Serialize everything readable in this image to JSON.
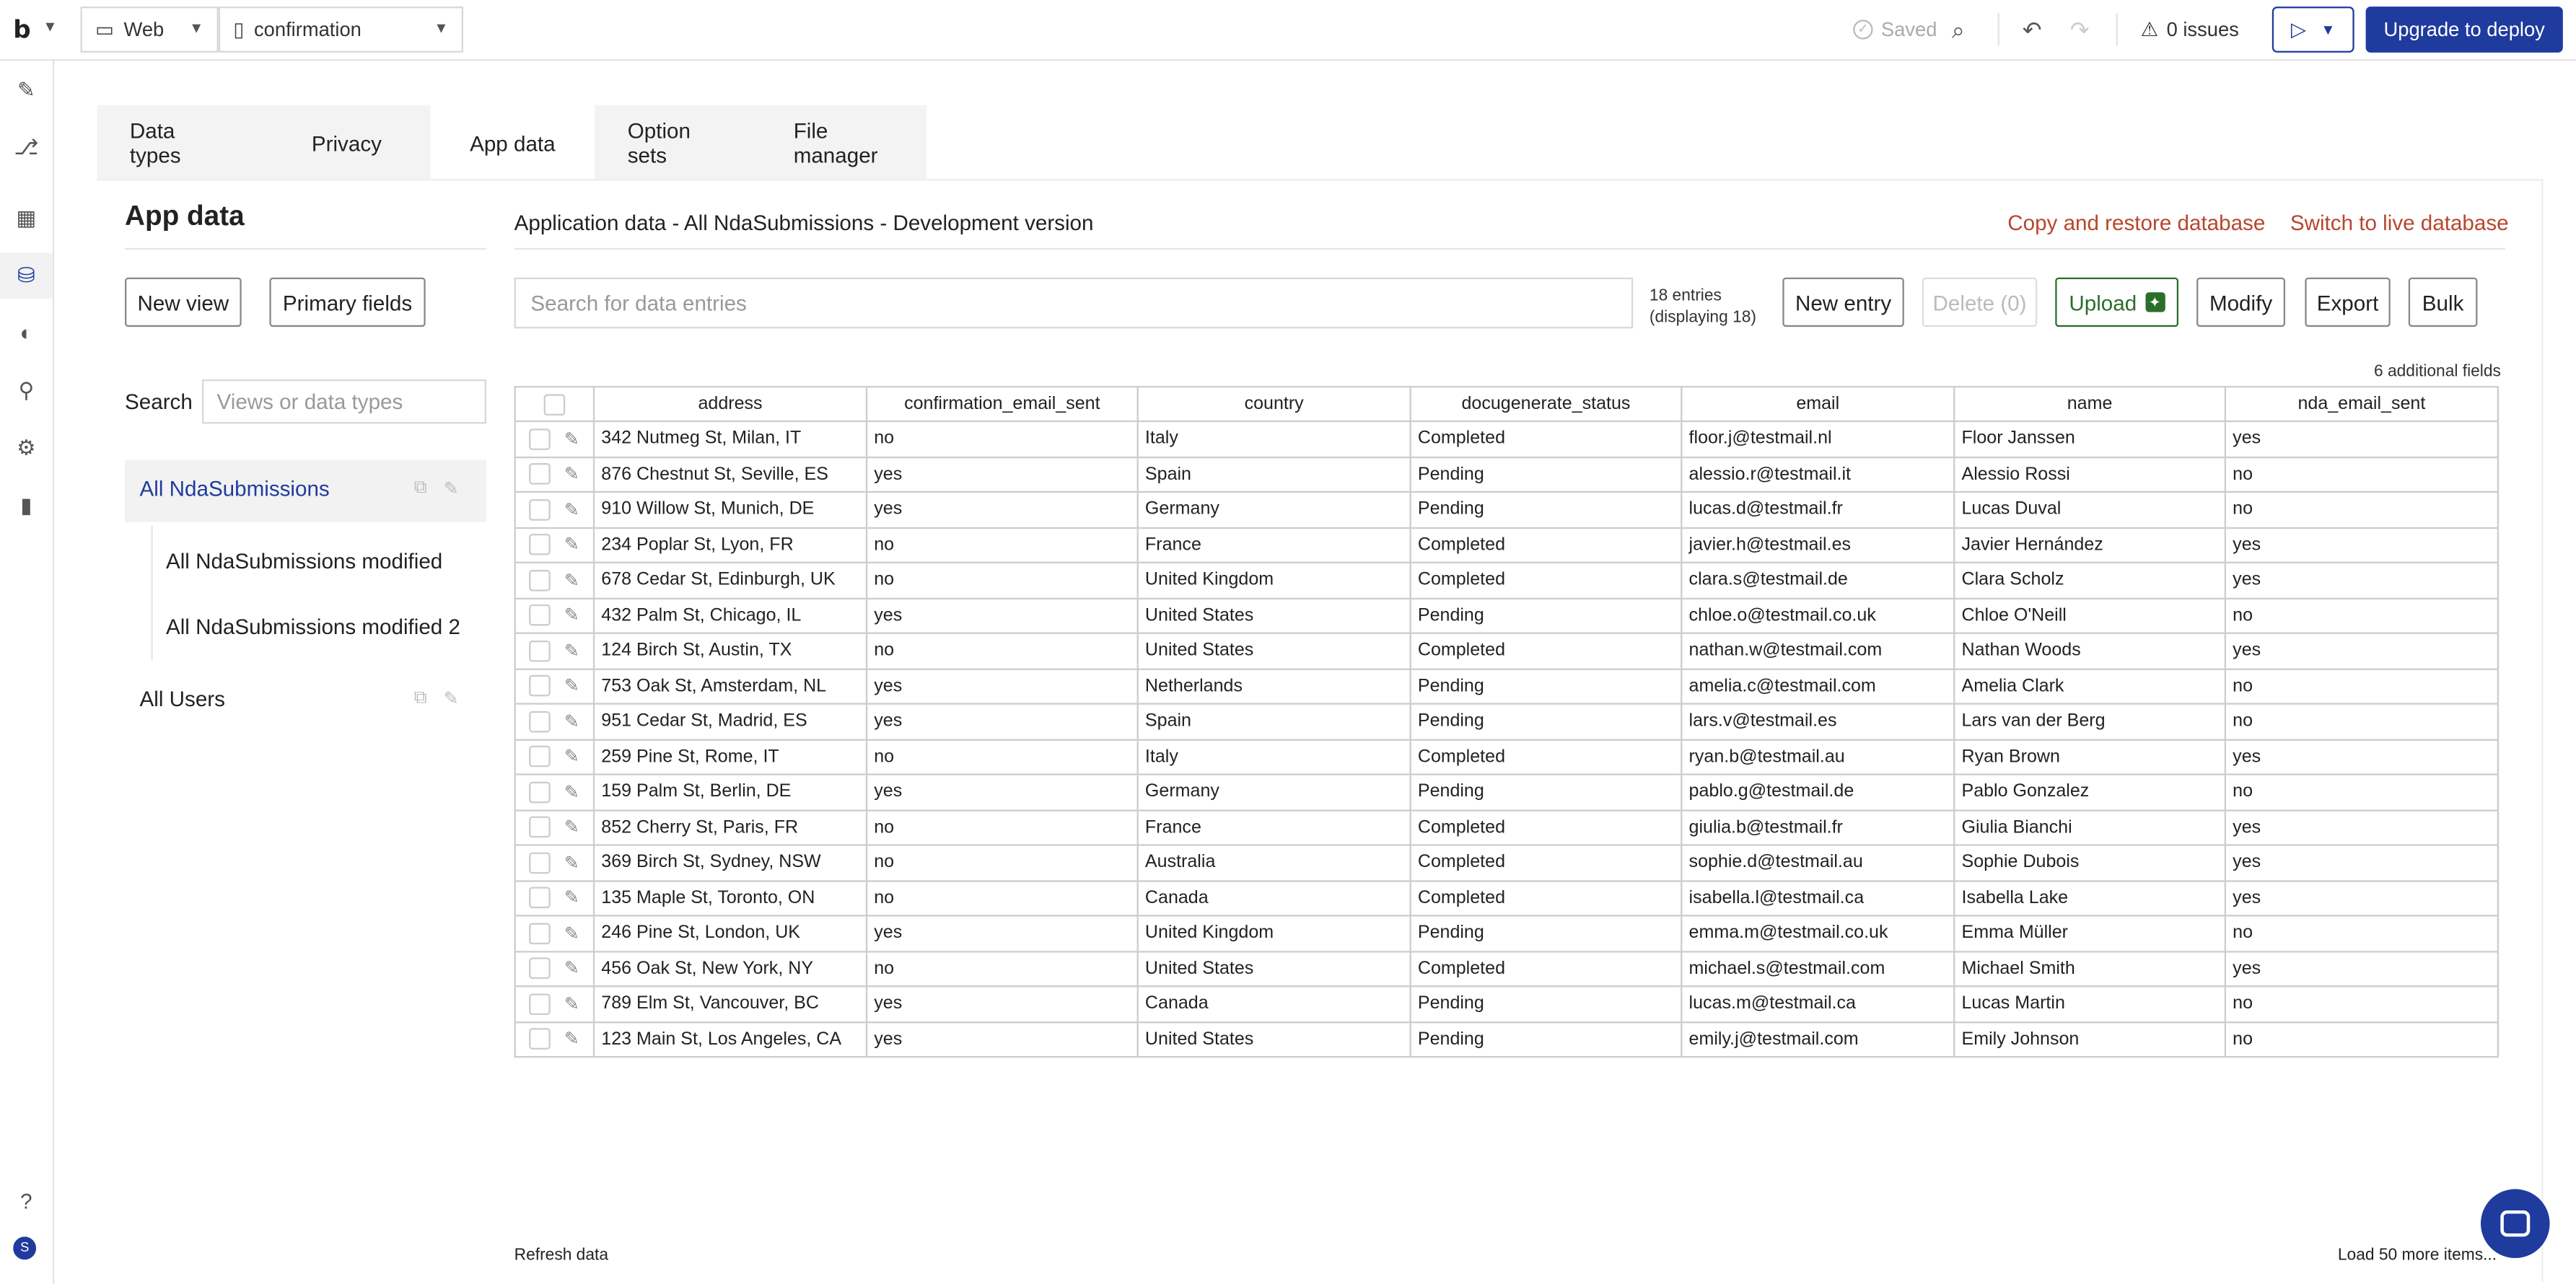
{
  "topbar": {
    "logo": "b",
    "platform": "Web",
    "page": "confirmation",
    "saved": "Saved",
    "issues": "0 issues",
    "deploy": "Upgrade to deploy"
  },
  "tabs": [
    "Data types",
    "Privacy",
    "App data",
    "Option sets",
    "File manager"
  ],
  "active_tab": "App data",
  "panel": {
    "title": "App data",
    "new_view": "New view",
    "primary_fields": "Primary fields",
    "search_label": "Search",
    "search_placeholder": "Views or data types",
    "views": {
      "v0": "All NdaSubmissions",
      "v1": "All NdaSubmissions modified",
      "v2": "All NdaSubmissions modified 2",
      "v3": "All Users"
    }
  },
  "main": {
    "title": "Application data - All NdaSubmissions - Development version",
    "copy_restore": "Copy and restore database",
    "switch_live": "Switch to live database",
    "search_placeholder": "Search for data entries",
    "entries_line1": "18 entries",
    "entries_line2": "(displaying 18)",
    "new_entry": "New entry",
    "delete": "Delete (0)",
    "upload": "Upload",
    "modify": "Modify",
    "export": "Export",
    "bulk": "Bulk",
    "additional_fields": "6 additional fields",
    "refresh": "Refresh data",
    "load_more": "Load 50 more items..."
  },
  "table": {
    "columns": [
      "address",
      "confirmation_email_sent",
      "country",
      "docugenerate_status",
      "email",
      "name",
      "nda_email_sent"
    ],
    "rows": [
      [
        "342 Nutmeg St, Milan, IT",
        "no",
        "Italy",
        "Completed",
        "floor.j@testmail.nl",
        "Floor Janssen",
        "yes"
      ],
      [
        "876 Chestnut St, Seville, ES",
        "yes",
        "Spain",
        "Pending",
        "alessio.r@testmail.it",
        "Alessio Rossi",
        "no"
      ],
      [
        "910 Willow St, Munich, DE",
        "yes",
        "Germany",
        "Pending",
        "lucas.d@testmail.fr",
        "Lucas Duval",
        "no"
      ],
      [
        "234 Poplar St, Lyon, FR",
        "no",
        "France",
        "Completed",
        "javier.h@testmail.es",
        "Javier Hernández",
        "yes"
      ],
      [
        "678 Cedar St, Edinburgh, UK",
        "no",
        "United Kingdom",
        "Completed",
        "clara.s@testmail.de",
        "Clara Scholz",
        "yes"
      ],
      [
        "432 Palm St, Chicago, IL",
        "yes",
        "United States",
        "Pending",
        "chloe.o@testmail.co.uk",
        "Chloe O'Neill",
        "no"
      ],
      [
        "124 Birch St, Austin, TX",
        "no",
        "United States",
        "Completed",
        "nathan.w@testmail.com",
        "Nathan Woods",
        "yes"
      ],
      [
        "753 Oak St, Amsterdam, NL",
        "yes",
        "Netherlands",
        "Pending",
        "amelia.c@testmail.com",
        "Amelia Clark",
        "no"
      ],
      [
        "951 Cedar St, Madrid, ES",
        "yes",
        "Spain",
        "Pending",
        "lars.v@testmail.es",
        "Lars van der Berg",
        "no"
      ],
      [
        "259 Pine St, Rome, IT",
        "no",
        "Italy",
        "Completed",
        "ryan.b@testmail.au",
        "Ryan Brown",
        "yes"
      ],
      [
        "159 Palm St, Berlin, DE",
        "yes",
        "Germany",
        "Pending",
        "pablo.g@testmail.de",
        "Pablo Gonzalez",
        "no"
      ],
      [
        "852 Cherry St, Paris, FR",
        "no",
        "France",
        "Completed",
        "giulia.b@testmail.fr",
        "Giulia Bianchi",
        "yes"
      ],
      [
        "369 Birch St, Sydney, NSW",
        "no",
        "Australia",
        "Completed",
        "sophie.d@testmail.au",
        "Sophie Dubois",
        "yes"
      ],
      [
        "135 Maple St, Toronto, ON",
        "no",
        "Canada",
        "Completed",
        "isabella.l@testmail.ca",
        "Isabella Lake",
        "yes"
      ],
      [
        "246 Pine St, London, UK",
        "yes",
        "United Kingdom",
        "Pending",
        "emma.m@testmail.co.uk",
        "Emma Müller",
        "no"
      ],
      [
        "456 Oak St, New York, NY",
        "no",
        "United States",
        "Completed",
        "michael.s@testmail.com",
        "Michael Smith",
        "yes"
      ],
      [
        "789 Elm St, Vancouver, BC",
        "yes",
        "Canada",
        "Pending",
        "lucas.m@testmail.ca",
        "Lucas Martin",
        "no"
      ],
      [
        "123 Main St, Los Angeles, CA",
        "yes",
        "United States",
        "Pending",
        "emily.j@testmail.com",
        "Emily Johnson",
        "no"
      ]
    ]
  },
  "rail_icons": [
    "pencil-icon",
    "workflow-icon",
    "layout-icon",
    "database-icon",
    "palette-icon",
    "plugin-icon",
    "settings-icon",
    "chart-icon",
    "help-icon"
  ],
  "avatar_letter": "S",
  "colors": {
    "brand": "#1f3b9e",
    "link": "#b8462c",
    "upload": "#2b6e2b"
  }
}
